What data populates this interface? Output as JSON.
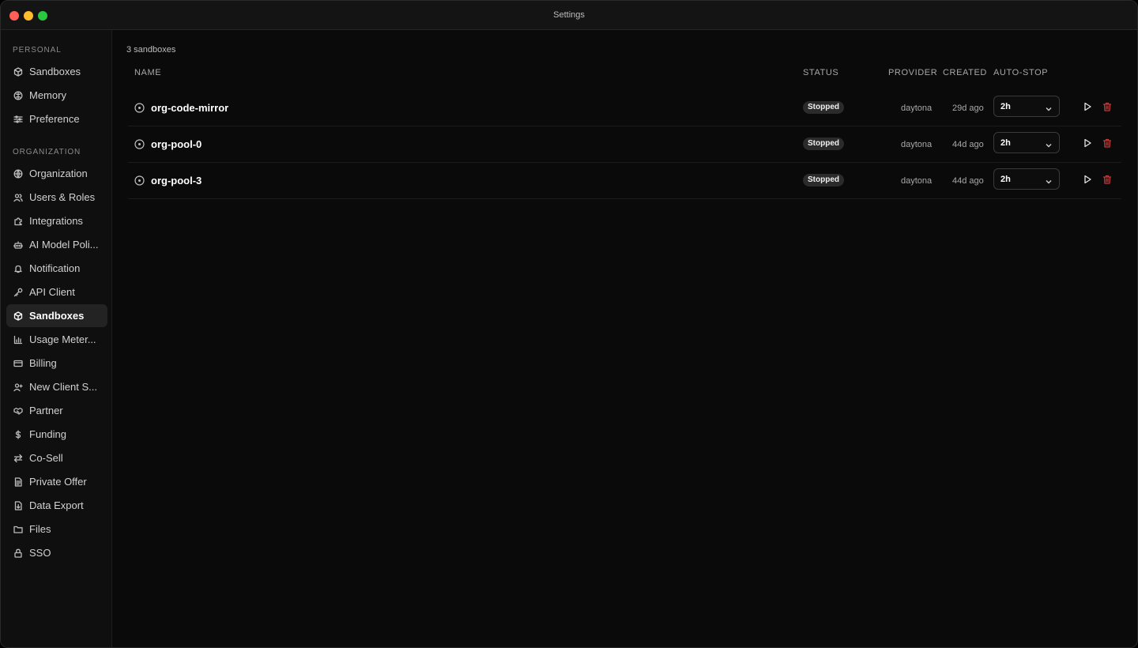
{
  "window": {
    "title": "Settings"
  },
  "sidebar": {
    "personal_label": "PERSONAL",
    "personal_items": [
      {
        "label": "Sandboxes",
        "icon": "cube-icon"
      },
      {
        "label": "Memory",
        "icon": "brain-icon"
      },
      {
        "label": "Preference",
        "icon": "sliders-icon"
      }
    ],
    "org_label": "ORGANIZATION",
    "org_items": [
      {
        "label": "Organization",
        "icon": "globe-icon"
      },
      {
        "label": "Users & Roles",
        "icon": "users-icon"
      },
      {
        "label": "Integrations",
        "icon": "puzzle-icon"
      },
      {
        "label": "AI Model Poli...",
        "icon": "robot-icon"
      },
      {
        "label": "Notification",
        "icon": "bell-icon"
      },
      {
        "label": "API Client",
        "icon": "key-icon"
      },
      {
        "label": "Sandboxes",
        "icon": "cube-icon",
        "active": true
      },
      {
        "label": "Usage Meter...",
        "icon": "bar-chart-icon"
      },
      {
        "label": "Billing",
        "icon": "credit-card-icon"
      },
      {
        "label": "New Client S...",
        "icon": "user-plus-icon"
      },
      {
        "label": "Partner",
        "icon": "handshake-icon"
      },
      {
        "label": "Funding",
        "icon": "dollar-icon"
      },
      {
        "label": "Co-Sell",
        "icon": "arrows-swap-icon"
      },
      {
        "label": "Private Offer",
        "icon": "document-icon"
      },
      {
        "label": "Data Export",
        "icon": "export-file-icon"
      },
      {
        "label": "Files",
        "icon": "folder-icon"
      },
      {
        "label": "SSO",
        "icon": "lock-icon"
      }
    ]
  },
  "main": {
    "count_text": "3 sandboxes",
    "columns": {
      "name": "NAME",
      "status": "STATUS",
      "provider": "PROVIDER",
      "created": "CREATED",
      "auto_stop": "AUTO-STOP"
    },
    "rows": [
      {
        "name": "org-code-mirror",
        "status": "Stopped",
        "provider": "daytona",
        "created": "29d ago",
        "auto_stop": "2h"
      },
      {
        "name": "org-pool-0",
        "status": "Stopped",
        "provider": "daytona",
        "created": "44d ago",
        "auto_stop": "2h"
      },
      {
        "name": "org-pool-3",
        "status": "Stopped",
        "provider": "daytona",
        "created": "44d ago",
        "auto_stop": "2h"
      }
    ]
  },
  "colors": {
    "background": "#0a0a0a",
    "sidebar_active": "#232323",
    "badge_bg": "#2b2b2b",
    "delete_red": "#c23a3a"
  }
}
